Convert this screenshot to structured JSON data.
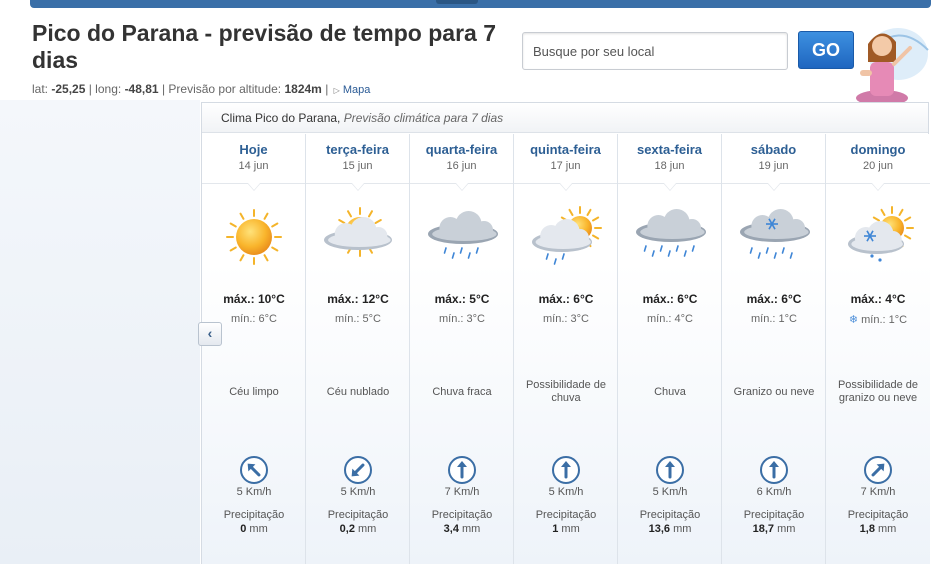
{
  "header": {
    "title": "Pico do Parana - previsão de tempo para 7 dias",
    "lat_label": "lat:",
    "lat": "-25,25",
    "long_label": "| long:",
    "long": "-48,81",
    "altitude_label": "| Previsão por altitude:",
    "altitude": "1824m",
    "sep": "|",
    "map_link": "Mapa"
  },
  "search": {
    "placeholder": "Busque por seu local",
    "go_label": "GO"
  },
  "panel": {
    "title": "Clima Pico do Parana,",
    "subtitle": "Previsão climática para 7 dias"
  },
  "nav": {
    "prev_icon": "chevron-left-icon",
    "prev_glyph": "‹"
  },
  "labels": {
    "max": "máx.:",
    "min": "mín.:",
    "precip": "Precipitação",
    "unit_mm": "mm"
  },
  "colors": {
    "accent": "#2d5f94",
    "go_button": "#2f7fd8",
    "wind_ring": "#3b6ea5"
  },
  "days": [
    {
      "name": "Hoje",
      "date": "14 jun",
      "icon": "sun-icon",
      "max": "10°C",
      "min": "6°C",
      "condition": "Céu limpo",
      "wind_dir_deg": 225,
      "wind_speed": "5 Km/h",
      "precip": "0",
      "snow": false
    },
    {
      "name": "terça-feira",
      "date": "15 jun",
      "icon": "sun-cloud-icon",
      "max": "12°C",
      "min": "5°C",
      "condition": "Céu nublado",
      "wind_dir_deg": 135,
      "wind_speed": "5 Km/h",
      "precip": "0,2",
      "snow": false
    },
    {
      "name": "quarta-feira",
      "date": "16 jun",
      "icon": "light-rain-icon",
      "max": "5°C",
      "min": "3°C",
      "condition": "Chuva fraca",
      "wind_dir_deg": 270,
      "wind_speed": "7 Km/h",
      "precip": "3,4",
      "snow": false
    },
    {
      "name": "quinta-feira",
      "date": "17 jun",
      "icon": "sun-cloud-rain-icon",
      "max": "6°C",
      "min": "3°C",
      "condition": "Possibilidade de chuva",
      "wind_dir_deg": 270,
      "wind_speed": "5 Km/h",
      "precip": "1",
      "snow": false
    },
    {
      "name": "sexta-feira",
      "date": "18 jun",
      "icon": "rain-icon",
      "max": "6°C",
      "min": "4°C",
      "condition": "Chuva",
      "wind_dir_deg": 270,
      "wind_speed": "5 Km/h",
      "precip": "13,6",
      "snow": false
    },
    {
      "name": "sábado",
      "date": "19 jun",
      "icon": "hail-snow-icon",
      "max": "6°C",
      "min": "1°C",
      "condition": "Granizo ou neve",
      "wind_dir_deg": 270,
      "wind_speed": "6 Km/h",
      "precip": "18,7",
      "snow": false
    },
    {
      "name": "domingo",
      "date": "20 jun",
      "icon": "sun-cloud-snow-icon",
      "max": "4°C",
      "min": "1°C",
      "condition": "Possibilidade de granizo ou neve",
      "wind_dir_deg": 315,
      "wind_speed": "7 Km/h",
      "precip": "1,8",
      "snow": true
    }
  ]
}
